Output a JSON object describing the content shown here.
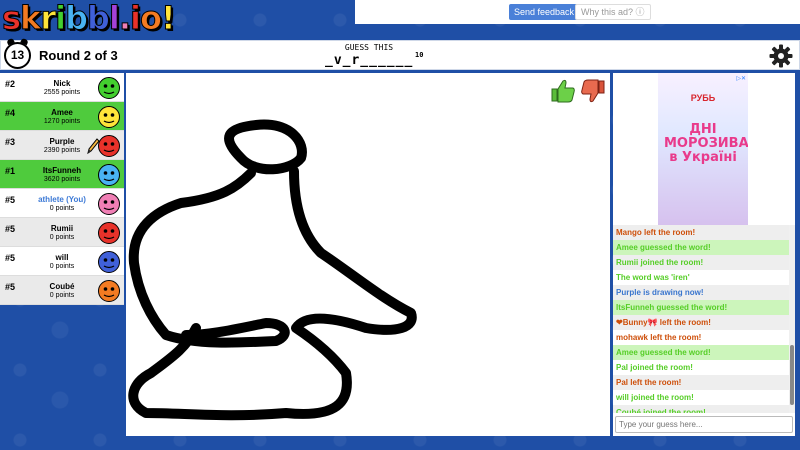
{
  "logo": {
    "letters": [
      "s",
      "k",
      "r",
      "i",
      "b",
      "b",
      "l",
      ".",
      "i",
      "o",
      "!"
    ],
    "colors": [
      "#e8322a",
      "#f37b22",
      "#ffe43a",
      "#43cf2f",
      "#49b3f2",
      "#4060d8",
      "#a542d8",
      "#f07fb5",
      "#e8322a",
      "#f37b22",
      "#ffe43a"
    ]
  },
  "ad_top": {
    "feedback_label": "Send feedback",
    "why_label": "Why this ad? ⓘ"
  },
  "topbar": {
    "timer": "13",
    "round": "Round 2 of 3",
    "guess_label": "GUESS THIS",
    "word_hint": "_v_r______",
    "word_length": "10"
  },
  "players": [
    {
      "rank": "#2",
      "name": "Nick",
      "points": "2555 points",
      "bg": "white",
      "face": "#43cf2f"
    },
    {
      "rank": "#4",
      "name": "Amee",
      "points": "1270 points",
      "bg": "green",
      "face": "#ffe43a"
    },
    {
      "rank": "#3",
      "name": "Purple",
      "points": "2390 points",
      "bg": "alt",
      "face": "#e8322a"
    },
    {
      "rank": "#1",
      "name": "ItsFunneh",
      "points": "3620 points",
      "bg": "green",
      "face": "#49b3f2"
    },
    {
      "rank": "#5",
      "name": "athlete (You)",
      "points": "0 points",
      "bg": "white",
      "face": "#f07fb5",
      "you": true
    },
    {
      "rank": "#5",
      "name": "Rumii",
      "points": "0 points",
      "bg": "alt",
      "face": "#e8322a"
    },
    {
      "rank": "#5",
      "name": "will",
      "points": "0 points",
      "bg": "white",
      "face": "#4060d8"
    },
    {
      "rank": "#5",
      "name": "Coubé",
      "points": "0 points",
      "bg": "alt",
      "face": "#f37b22"
    }
  ],
  "ad_right": {
    "tag": "▷✕",
    "brand": "РУБЬ",
    "headline": "ДНІ МОРОЗИВА в Україні"
  },
  "chat": [
    {
      "text": "Mango left the room!",
      "style": "red alt"
    },
    {
      "text": "Amee guessed the word!",
      "style": "green bg"
    },
    {
      "text": "Rumii joined the room!",
      "style": "green alt"
    },
    {
      "text": "The word was 'iren'",
      "style": "green"
    },
    {
      "text": "Purple is drawing now!",
      "style": "blue alt"
    },
    {
      "text": "ItsFunneh guessed the word!",
      "style": "green bg"
    },
    {
      "text": "❤Bunny🎀 left the room!",
      "style": "red alt"
    },
    {
      "text": "mohawk left the room!",
      "style": "red"
    },
    {
      "text": "Amee guessed the word!",
      "style": "green bg"
    },
    {
      "text": "Pal joined the room!",
      "style": "green"
    },
    {
      "text": "Pal left the room!",
      "style": "red alt"
    },
    {
      "text": "will joined the room!",
      "style": "green"
    },
    {
      "text": "Coubé joined the room!",
      "style": "green alt"
    }
  ],
  "chat_input": {
    "placeholder": "Type your guess here..."
  },
  "icons": {
    "gear": "gear-icon",
    "thumbs_up": "thumbs-up-icon",
    "thumbs_down": "thumbs-down-icon",
    "pencil": "pencil-icon",
    "clock": "alarm-clock-icon"
  }
}
